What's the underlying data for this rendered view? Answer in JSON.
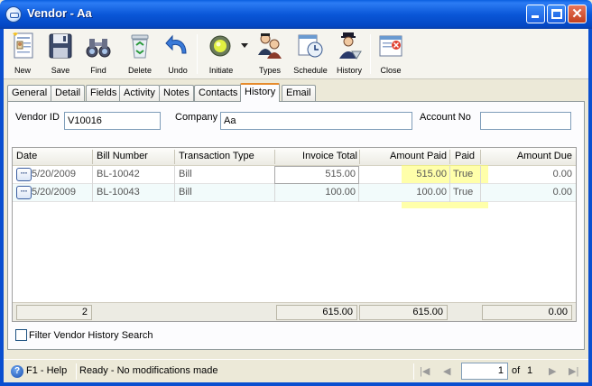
{
  "window": {
    "title": "Vendor - Aa"
  },
  "toolbar": {
    "new": "New",
    "save": "Save",
    "find": "Find",
    "delete": "Delete",
    "undo": "Undo",
    "initiate": "Initiate",
    "types": "Types",
    "schedule": "Schedule",
    "history": "History",
    "close": "Close"
  },
  "tabs": [
    "General",
    "Detail",
    "Fields",
    "Activity",
    "Notes",
    "Contacts",
    "History",
    "Email"
  ],
  "active_tab": "History",
  "form": {
    "vendor_id_label": "Vendor ID",
    "vendor_id": "V10016",
    "company_label": "Company",
    "company": "Aa",
    "account_label": "Account No",
    "account": ""
  },
  "grid": {
    "columns": [
      "Date",
      "Bill Number",
      "Transaction Type",
      "Invoice Total",
      "Amount Paid",
      "Paid",
      "Amount Due"
    ],
    "rows": [
      {
        "date": "5/20/2009",
        "bill": "BL-10042",
        "type": "Bill",
        "invoice": "515.00",
        "paid_amt": "515.00",
        "paid": "True",
        "due": "0.00"
      },
      {
        "date": "5/20/2009",
        "bill": "BL-10043",
        "type": "Bill",
        "invoice": "100.00",
        "paid_amt": "100.00",
        "paid": "True",
        "due": "0.00"
      }
    ],
    "footer": {
      "count": "2",
      "invoice": "615.00",
      "paid_amt": "615.00",
      "due": "0.00"
    },
    "row_button": "···"
  },
  "filter_label": "Filter Vendor History Search",
  "status": {
    "help": "F1 - Help",
    "message": "Ready - No modifications made",
    "page": "1",
    "of_label": "of",
    "total_pages": "1"
  },
  "colors": {
    "titlebar": "#0a57d8",
    "highlight": "#ffff64",
    "tab_accent": "#e68b2c"
  }
}
